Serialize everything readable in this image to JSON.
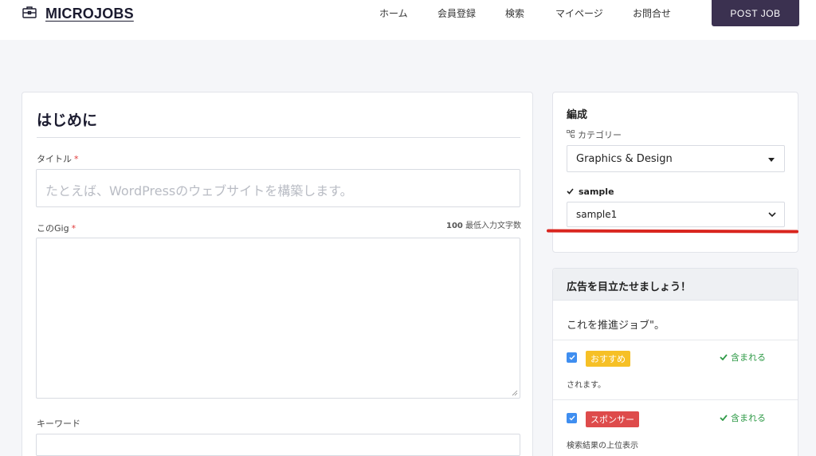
{
  "header": {
    "brand": "MICROJOBS",
    "nav": [
      "ホーム",
      "会員登録",
      "検索",
      "マイページ",
      "お問合せ"
    ],
    "post_button": "POST JOB"
  },
  "form": {
    "section_title": "はじめに",
    "title_label": "タイトル",
    "title_placeholder": "たとえば、WordPressのウェブサイトを構築します。",
    "required_mark": "*",
    "gig_label": "このGig",
    "min_chars_number": "100",
    "min_chars_text": "最低入力文字数",
    "keyword_label": "キーワード"
  },
  "sidebar": {
    "composition_title": "編成",
    "category_label": "カテゴリー",
    "category_value": "Graphics & Design",
    "sample_label": "sample",
    "sample_value": "sample1"
  },
  "promo": {
    "title": "広告を目立たせましょう！",
    "intro": "これを推進ジョブ\"。",
    "items": [
      {
        "badge": "おすすめ",
        "included": "含まれる",
        "desc": "されます。"
      },
      {
        "badge": "スポンサー",
        "included": "含まれる",
        "desc": "検索結果の上位表示"
      }
    ]
  },
  "colors": {
    "accent": "#3b3150",
    "highlight_line": "#d9251e",
    "badge_featured": "#f6c026",
    "badge_sponsor": "#de4b4b",
    "included_green": "#2f9a47",
    "checkbox_blue": "#3f8ef0"
  }
}
